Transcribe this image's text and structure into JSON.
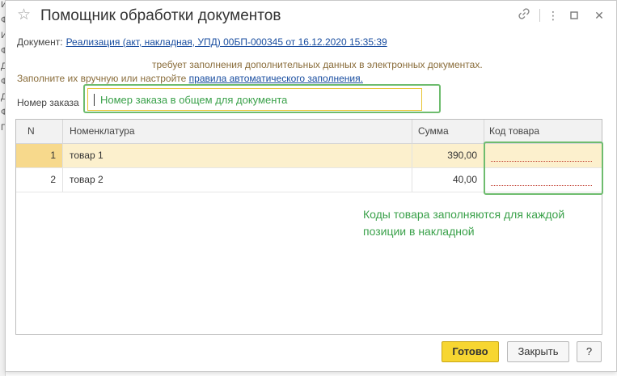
{
  "window": {
    "title": "Помощник обработки документов",
    "icons": [
      "star-icon",
      "link-icon",
      "more-icon",
      "maximize-icon",
      "close-icon"
    ]
  },
  "background": {
    "fragments": [
      "ИЗ",
      "Ф",
      "ИЗ",
      "Ф",
      "Д",
      "Ф",
      "Д",
      "Ф",
      "Г"
    ]
  },
  "document": {
    "label": "Документ:",
    "link_text": "Реализация (акт, накладная, УПД) 00БП-000345 от 16.12.2020 15:35:39"
  },
  "notes": {
    "line1": "требует заполнения дополнительных данных в электронных документах.",
    "line2_prefix": "Заполните их вручную или настройте ",
    "line2_link": "правила автоматического заполнения."
  },
  "order": {
    "label": "Номер заказа",
    "value": "Номер заказа в общем для документа"
  },
  "table": {
    "columns": [
      "N",
      "Номенклатура",
      "Сумма",
      "Код товара"
    ],
    "rows": [
      {
        "n": "1",
        "item": "товар 1",
        "sum": "390,00",
        "code": ""
      },
      {
        "n": "2",
        "item": "товар 2",
        "sum": "40,00",
        "code": ""
      }
    ],
    "selected_row": 1
  },
  "annotation": {
    "line1": "Коды товара заполняются для каждой",
    "line2": "позиции в накладной"
  },
  "buttons": {
    "ok": "Готово",
    "close": "Закрыть",
    "help": "?"
  },
  "colors": {
    "link": "#1a4ea0",
    "note": "#8a6d3b",
    "annotation_green": "#3aa14a",
    "primary_button": "#f7d631",
    "selected_row": "#fcf0cd"
  }
}
